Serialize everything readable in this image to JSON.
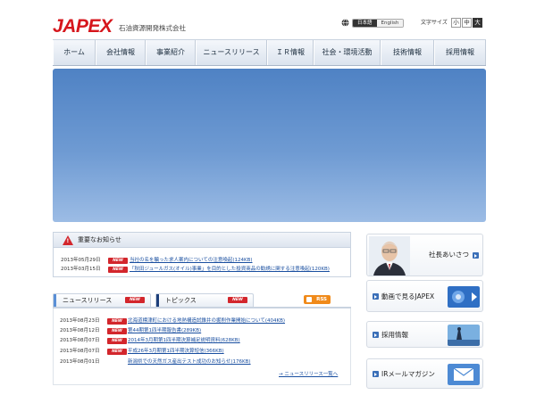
{
  "header": {
    "logo_text": "JAPEX",
    "company_name": "石油資源開発株式会社",
    "language": {
      "japanese": "日本語",
      "english": "English"
    },
    "font_size": {
      "label": "文字サイズ",
      "small": "小",
      "medium": "中",
      "large": "大"
    }
  },
  "nav": {
    "items": [
      {
        "label": "ホーム"
      },
      {
        "label": "会社情報"
      },
      {
        "label": "事業紹介"
      },
      {
        "label": "ニュースリリース"
      },
      {
        "label": "ＩＲ情報"
      },
      {
        "label": "社会・環境活動"
      },
      {
        "label": "技術情報"
      },
      {
        "label": "採用情報"
      }
    ]
  },
  "notice": {
    "title": "重要なお知らせ",
    "items": [
      {
        "date": "2013年05月29日",
        "badge": "NEW",
        "text": "当社の名を騙った求人案内についての注意喚起(124KB)"
      },
      {
        "date": "2013年03月15日",
        "badge": "NEW",
        "text": "「秋田ジュールガス(オイル)事業」を目的とした投資商品の勧誘に関する注意喚起(120KB)"
      }
    ]
  },
  "news": {
    "tabs": {
      "news_release": "ニュースリリース",
      "topics": "トピックス",
      "badge": "NEW"
    },
    "rss_label": "RSS",
    "items": [
      {
        "date": "2013年08月23日",
        "badge": "NEW",
        "text": "北海道標津町における地熱構造試錐井の掘削作業開始について(404KB)"
      },
      {
        "date": "2013年08月12日",
        "badge": "NEW",
        "text": "第44期第1四半期報告書(289KB)"
      },
      {
        "date": "2013年08月07日",
        "badge": "NEW",
        "text": "2014年3月期第1四半期決算補足説明資料(628KB)"
      },
      {
        "date": "2013年08月07日",
        "badge": "NEW",
        "text": "平成26年3月期第1四半期決算短信(366KB)"
      },
      {
        "date": "2013年08月01日",
        "badge": "",
        "text": "新潟県での天然ガス産出テスト成功のお知らせ(176KB)"
      }
    ],
    "more_link": "→ ニュースリリース一覧へ"
  },
  "sidebar": {
    "president": "社長あいさつ",
    "video": "動画で見るJAPEX",
    "recruit": "採用情報",
    "ir_mail": "IRメールマガジン"
  }
}
